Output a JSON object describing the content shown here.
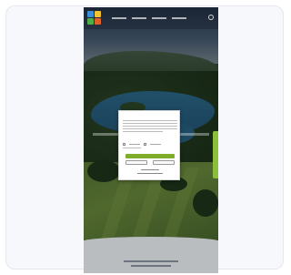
{
  "hero": {
    "title": ""
  },
  "footer": {
    "title": ""
  },
  "consent_dialog": {
    "title": ""
  },
  "colors": {
    "accent_green": "#7fae2a",
    "side_tab": "#8bbf3a",
    "footer_bg": "#b9bdc0",
    "footer_title": "#2c3e5c"
  },
  "icons": [
    "logo-icon",
    "search-icon"
  ]
}
